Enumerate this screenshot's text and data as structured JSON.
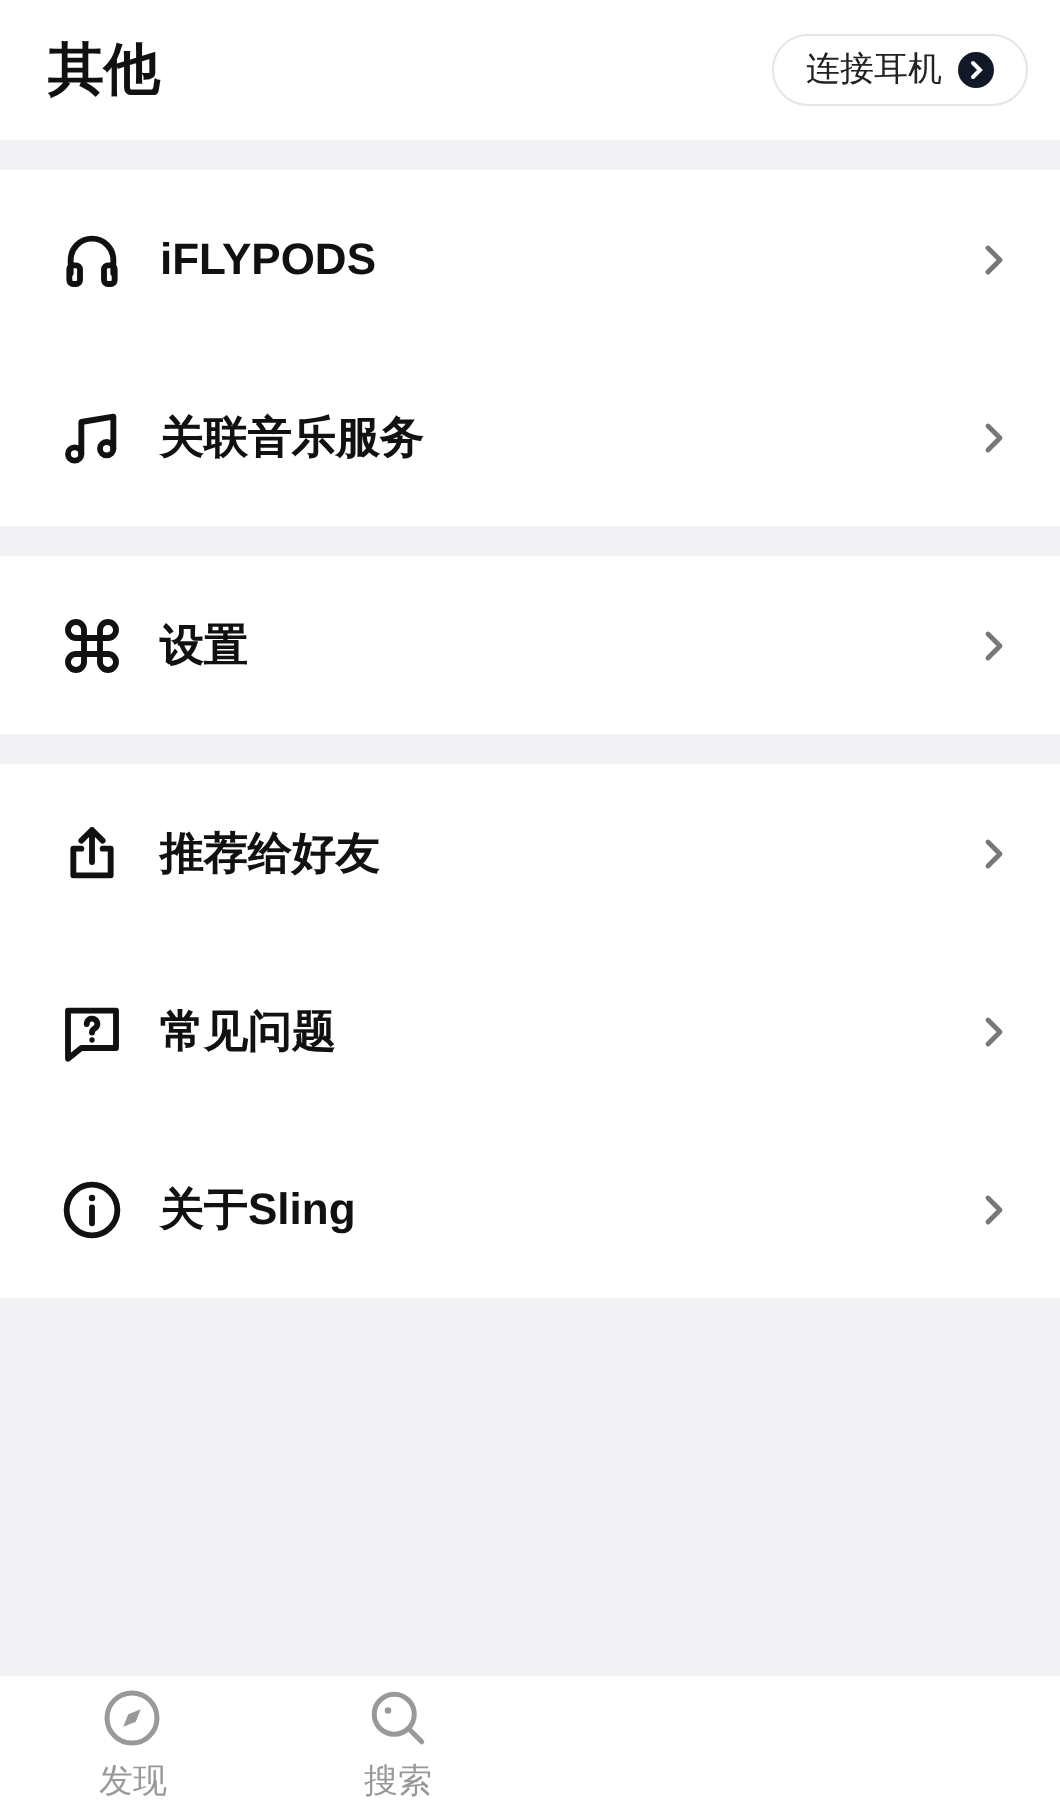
{
  "header": {
    "title": "其他",
    "connect_button": "连接耳机"
  },
  "groups": [
    {
      "items": [
        {
          "label": "iFLYPODS"
        },
        {
          "label": "关联音乐服务"
        }
      ]
    },
    {
      "items": [
        {
          "label": "设置"
        }
      ]
    },
    {
      "items": [
        {
          "label": "推荐给好友"
        },
        {
          "label": "常见问题"
        },
        {
          "label": "关于Sling"
        }
      ]
    }
  ],
  "tab_bar": {
    "tabs": [
      {
        "label": "发现"
      },
      {
        "label": "搜索"
      }
    ]
  }
}
